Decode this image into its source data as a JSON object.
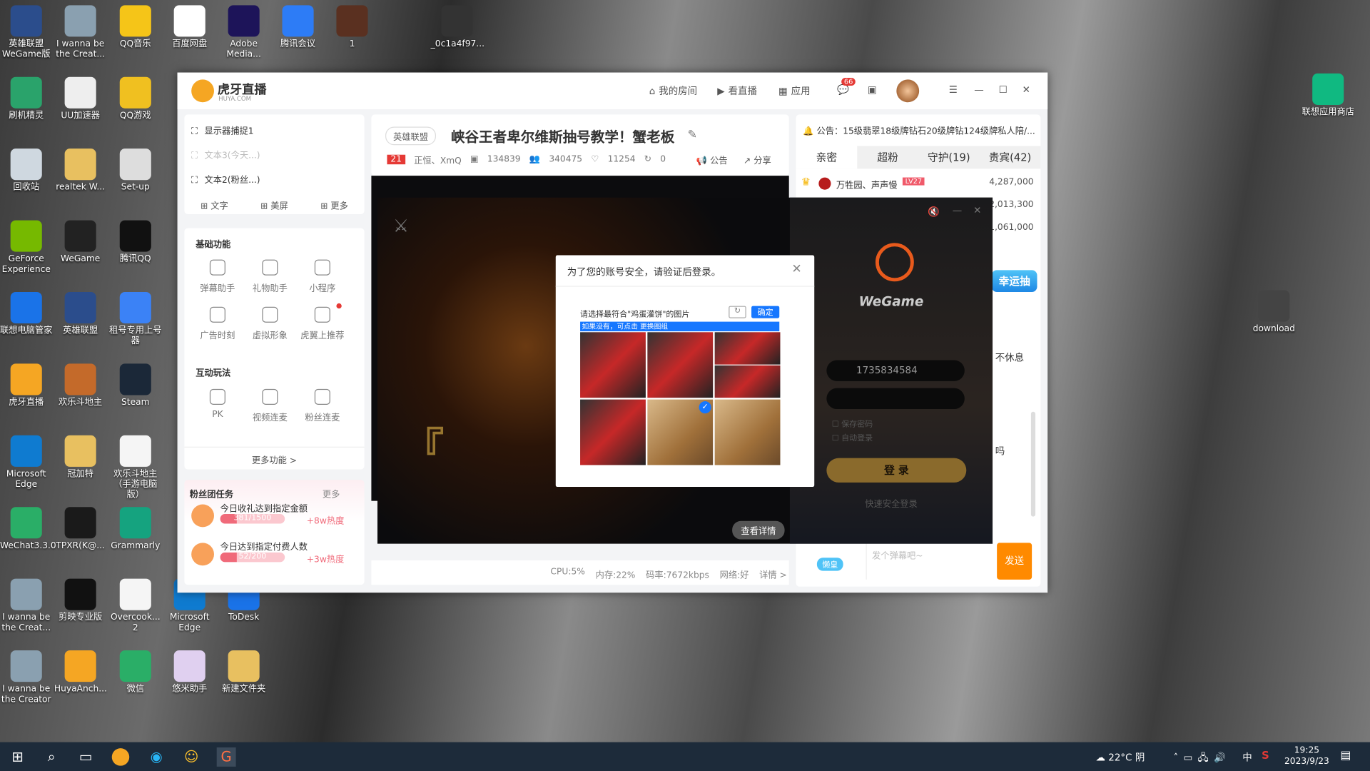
{
  "desktop": {
    "icons": [
      {
        "label": "英雄联盟WeGame版",
        "color": "#2b4d8c"
      },
      {
        "label": "I wanna be the Creat...",
        "color": "#8aa0b0"
      },
      {
        "label": "QQ音乐",
        "color": "#f5c518"
      },
      {
        "label": "百度网盘",
        "color": "#ffffff"
      },
      {
        "label": "Adobe Media...",
        "color": "#1d1459"
      },
      {
        "label": "腾讯会议",
        "color": "#2d7cf6"
      },
      {
        "label": "1",
        "color": "#5a3020"
      },
      {
        "label": "_0c1a4f97...",
        "color": "#333333"
      },
      {
        "label": "刷机精灵",
        "color": "#2aa36b"
      },
      {
        "label": "UU加速器",
        "color": "#eeeeee"
      },
      {
        "label": "QQ游戏",
        "color": "#f0c020"
      },
      {
        "label": "回收站",
        "color": "#cfd8e0"
      },
      {
        "label": "realtek W...",
        "color": "#e8c060"
      },
      {
        "label": "Set-up",
        "color": "#dddddd"
      },
      {
        "label": "GeForce Experience",
        "color": "#76b900"
      },
      {
        "label": "WeGame",
        "color": "#222222"
      },
      {
        "label": "腾讯QQ",
        "color": "#111111"
      },
      {
        "label": "联想电脑管家",
        "color": "#1a73e8"
      },
      {
        "label": "英雄联盟",
        "color": "#2b4d8c"
      },
      {
        "label": "租号专用上号器",
        "color": "#3b82f6"
      },
      {
        "label": "虎牙直播",
        "color": "#f5a623"
      },
      {
        "label": "欢乐斗地主",
        "color": "#c46a2a"
      },
      {
        "label": "Steam",
        "color": "#1b2838"
      },
      {
        "label": "Microsoft Edge",
        "color": "#0f7bd0"
      },
      {
        "label": "冠加特",
        "color": "#e8c060"
      },
      {
        "label": "欢乐斗地主（手游电脑版）",
        "color": "#f5f5f5"
      },
      {
        "label": "WeChat3.3.0",
        "color": "#2aae67"
      },
      {
        "label": "TPXR(K@...",
        "color": "#1a1a1a"
      },
      {
        "label": "Grammarly",
        "color": "#15a37f"
      },
      {
        "label": "I wanna be the Creat...",
        "color": "#8aa0b0"
      },
      {
        "label": "剪映专业版",
        "color": "#111111"
      },
      {
        "label": "Overcook... 2",
        "color": "#f5f5f5"
      },
      {
        "label": "Microsoft Edge",
        "color": "#0f7bd0"
      },
      {
        "label": "ToDesk",
        "color": "#1a73e8"
      },
      {
        "label": "I wanna be the Creator",
        "color": "#8aa0b0"
      },
      {
        "label": "HuyaAnch...",
        "color": "#f5a623"
      },
      {
        "label": "微信",
        "color": "#2aae67"
      },
      {
        "label": "悠米助手",
        "color": "#e0d0f0"
      },
      {
        "label": "新建文件夹",
        "color": "#e8c060"
      },
      {
        "label": "联想应用商店",
        "color": "#10b981"
      },
      {
        "label": "download",
        "color": "#444444"
      }
    ]
  },
  "app": {
    "logo": "虎牙直播",
    "logo_sub": "HUYA.COM",
    "nav": {
      "my_room": "我的房间",
      "watch_live": "看直播",
      "apps": "应用",
      "msg_badge": "66"
    },
    "sources": [
      {
        "label": "显示器捕捉1"
      },
      {
        "label": "文本3(今天...)"
      },
      {
        "label": "文本2(粉丝...)"
      }
    ],
    "add_buttons": [
      "文字",
      "美屏",
      "更多"
    ],
    "basic": {
      "title": "基础功能",
      "items": [
        "弹幕助手",
        "礼物助手",
        "小程序",
        "广告时刻",
        "虚拟形象",
        "虎翼上推荐"
      ]
    },
    "interact": {
      "title": "互动玩法",
      "items": [
        "PK",
        "视频连麦",
        "粉丝连麦"
      ]
    },
    "more_functions": "更多功能 >",
    "fan_tasks": {
      "title": "粉丝团任务",
      "more": "更多",
      "tasks": [
        {
          "label": "今日收礼达到指定金额",
          "progress": "381/1500",
          "fraction": 0.254,
          "reward": "+8w热度"
        },
        {
          "label": "今日达到指定付费人数",
          "progress": "52/200",
          "fraction": 0.26,
          "reward": "+3w热度"
        }
      ]
    },
    "room": {
      "category": "英雄联盟",
      "title": "峡谷王者卑尔维斯抽号教学！蟹老板",
      "level": "21",
      "streamer": "正恒、XmQ",
      "room_id": "134839",
      "viewers": "340475",
      "likes": "11254",
      "shares": "0",
      "announce": "公告",
      "share": "分享"
    },
    "status": {
      "cpu": "CPU:5%",
      "mem": "内存:22%",
      "bitrate": "码率:7672kbps",
      "net": "网络:好",
      "detail": "详情 >"
    },
    "view_detail": "查看详情",
    "right": {
      "notice": "公告：15级翡翠18级牌钻石20级牌钻124级牌私人陪/...",
      "tabs": [
        "亲密",
        "超粉",
        "守护(19)",
        "贵宾(42)"
      ],
      "ranks": [
        {
          "name": "万牲园、声声慢",
          "badge": "LV27",
          "value": "4,287,000"
        },
        {
          "value": "2,013,300"
        },
        {
          "value": "1,061,000"
        }
      ],
      "lucky": "幸运抽",
      "chat1": "不休息",
      "chat2": "吗",
      "input_placeholder": "发个弹幕吧~",
      "fan_badge": "懒皇",
      "send": "发送"
    }
  },
  "wegame": {
    "brand": "WeGame",
    "account": "1735834584",
    "remember": "保存密码",
    "auto_login": "自动登录",
    "login": "登 录",
    "quick_login": "快速安全登录"
  },
  "captcha": {
    "title": "为了您的账号安全，请验证后登录。",
    "prompt": "请选择最符合\"鸡蛋灌饼\"的图片",
    "confirm": "确定",
    "hint": "如果没有，可点击 更换图组",
    "tiles": [
      "car",
      "car",
      "car",
      "car",
      "car",
      "food",
      "food",
      "food"
    ],
    "selected_index": 5
  },
  "taskbar": {
    "weather": "22°C 阴",
    "ime": "中",
    "time": "19:25",
    "date": "2023/9/23"
  }
}
